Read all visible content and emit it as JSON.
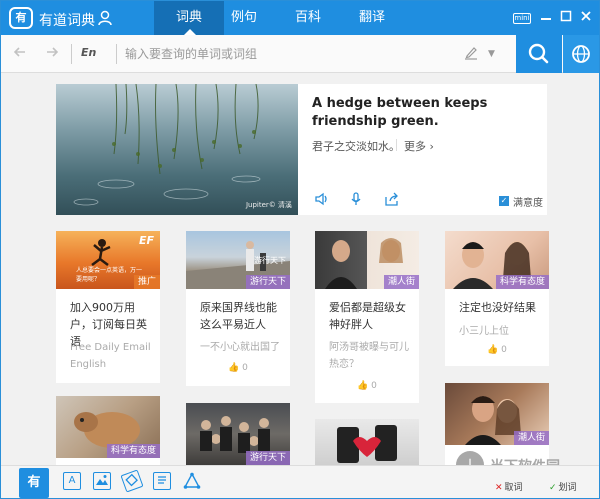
{
  "app": {
    "title": "有道词典",
    "mini": "mini"
  },
  "tabs": [
    {
      "label": "词典",
      "active": true
    },
    {
      "label": "例句",
      "active": false
    },
    {
      "label": "百科",
      "active": false
    },
    {
      "label": "翻译",
      "active": false
    }
  ],
  "search": {
    "lang": "En",
    "placeholder": "输入要查询的单词或词组"
  },
  "feature": {
    "sentence_en": "A hedge between keeps friendship green.",
    "sentence_cn": "君子之交淡如水。",
    "more": "更多",
    "credit": "Jupiter© 清溪",
    "satisfaction": "满意度"
  },
  "cards": [
    {
      "badge": "推广",
      "title": "加入900万用户，订阅每日英语",
      "sub": "Free Daily Email English",
      "likes": ""
    },
    {
      "badge": "游行天下",
      "title": "原来国界线也能这么平易近人",
      "sub": "一不小心就出国了",
      "likes": "0"
    },
    {
      "badge": "潮人街",
      "title": "爱侣都是超级女神好胖人",
      "sub": "阿汤哥被曝与可儿热恋？",
      "likes": "0"
    },
    {
      "badge": "科学有态度",
      "title": "注定也没好结果",
      "sub": "小三儿上位",
      "likes": "0"
    },
    {
      "badge": "科学有态度",
      "title": "",
      "sub": "",
      "likes": ""
    },
    {
      "badge": "游行天下",
      "title": "",
      "sub": "",
      "likes": ""
    },
    {
      "badge": "",
      "title": "",
      "sub": "",
      "likes": ""
    },
    {
      "badge": "潮人街",
      "title": "",
      "sub": "",
      "likes": ""
    }
  ],
  "card_img_overlay": {
    "ef_logo": "EF",
    "ad_line": "人总要会一点英语，万一要用呢？",
    "group_tag": "游行天下"
  },
  "bottom": {
    "checks": [
      {
        "mark": "✕",
        "label": "取词"
      },
      {
        "mark": "✓",
        "label": "划词"
      }
    ]
  },
  "watermark": {
    "text": "当下软件园"
  },
  "colors": {
    "brand": "#1f8ee0",
    "brand_dark": "#156fb5",
    "badge": "#9a6ec8"
  }
}
